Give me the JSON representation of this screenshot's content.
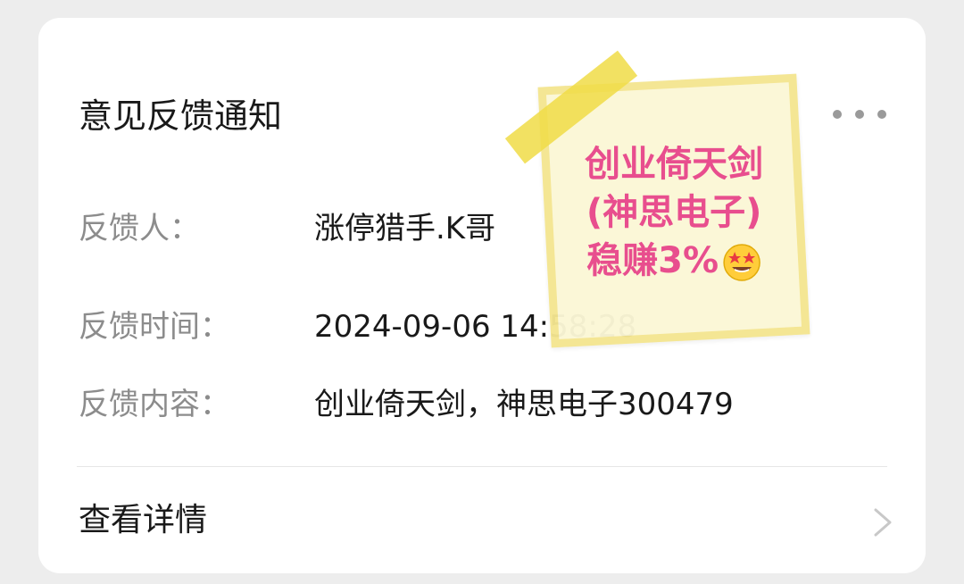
{
  "card": {
    "title": "意见反馈通知",
    "more_icon": "more-horizontal-icon",
    "fields": [
      {
        "label": "反馈人：",
        "value": "涨停猎手.K哥"
      },
      {
        "label": "反馈时间：",
        "value": "2024-09-06 14:58:28"
      },
      {
        "label": "反馈内容：",
        "value": "创业倚天剑，神思电子300479"
      }
    ],
    "detail_label": "查看详情",
    "detail_icon": "chevron-right-icon"
  },
  "sticky_note": {
    "line1": "创业倚天剑",
    "line2": "(神思电子)",
    "line3": "稳赚3%",
    "emoji": "star-struck-emoji"
  },
  "colors": {
    "background": "#ededed",
    "card": "#ffffff",
    "label_text": "#8c8c8c",
    "value_text": "#191919",
    "note_text": "#e8478a",
    "note_bg": "#fbf7d6",
    "tape": "#f0dc46"
  }
}
